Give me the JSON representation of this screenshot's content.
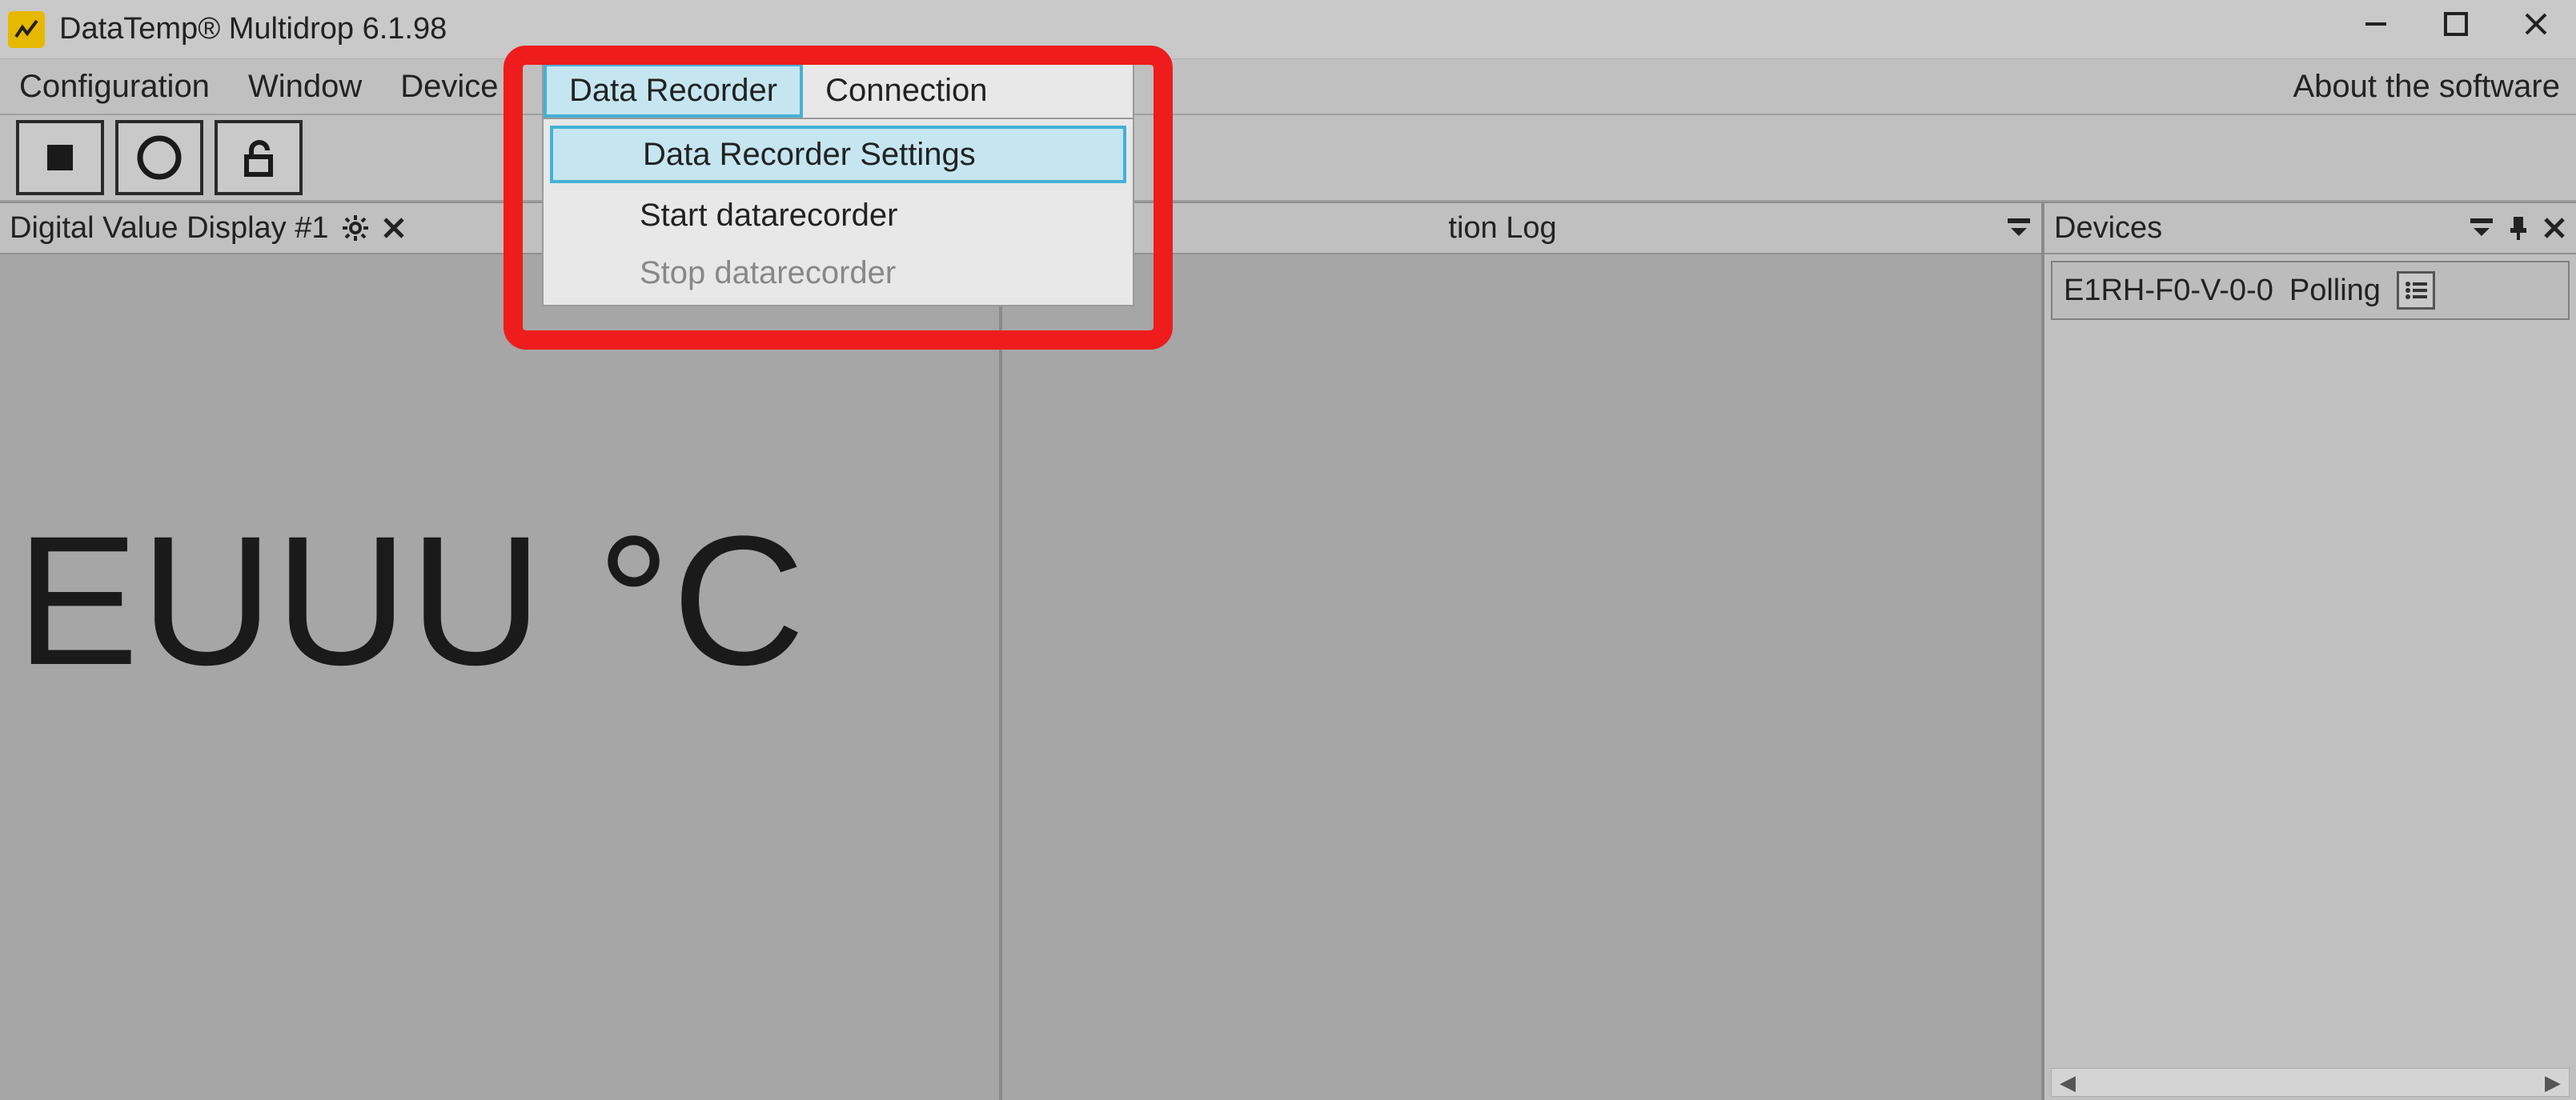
{
  "window": {
    "title": "DataTemp® Multidrop 6.1.98"
  },
  "menubar": {
    "items": [
      "Configuration",
      "Window",
      "Device"
    ],
    "right": "About the software"
  },
  "dropdown": {
    "header": [
      "Data Recorder",
      "Connection"
    ],
    "items": [
      {
        "label": "Data Recorder Settings",
        "state": "highlight"
      },
      {
        "label": "Start datarecorder",
        "state": "normal"
      },
      {
        "label": "Stop datarecorder",
        "state": "disabled"
      }
    ]
  },
  "panels": {
    "left": {
      "title": "Digital Value Display #1"
    },
    "center": {
      "title_suffix": "tion Log"
    },
    "right": {
      "title": "Devices"
    }
  },
  "reading": "EUUU °C",
  "devices": [
    {
      "name": "E1RH-F0-V-0-0",
      "status": "Polling"
    }
  ]
}
